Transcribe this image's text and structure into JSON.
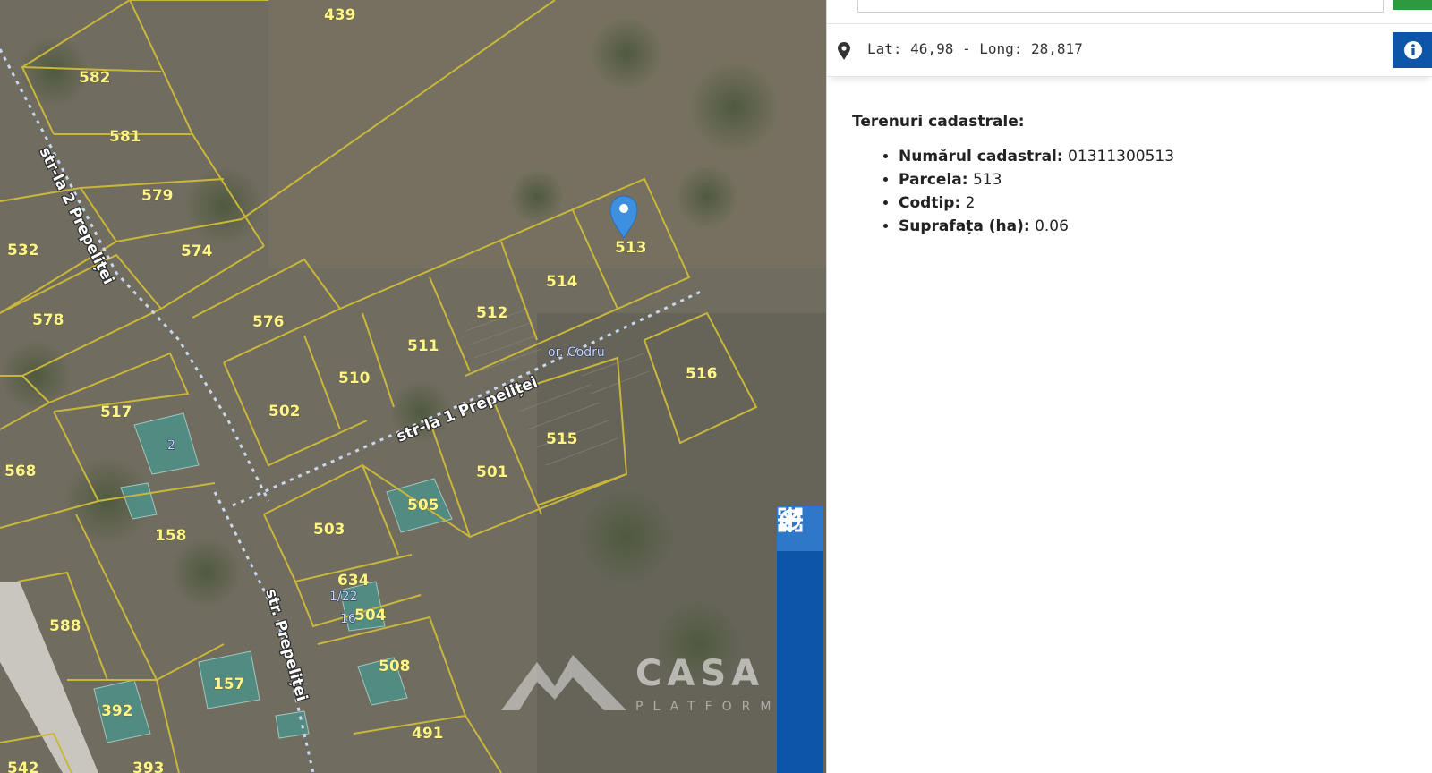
{
  "map": {
    "parcels": [
      "439",
      "582",
      "581",
      "579",
      "574",
      "532",
      "578",
      "576",
      "513",
      "514",
      "512",
      "511",
      "510",
      "502",
      "517",
      "2",
      "516",
      "515",
      "501",
      "505",
      "503",
      "568",
      "158",
      "634",
      "1/22",
      "16",
      "504",
      "588",
      "508",
      "157",
      "392",
      "491",
      "542",
      "393"
    ],
    "streets": [
      "str-la 2 Prepeliței",
      "str-la 1 Prepeliței",
      "str. Prepeliței"
    ],
    "area_name": "or. Codru",
    "watermark": {
      "title": "CASA M",
      "subtitle": "PLATFORMĂ I"
    },
    "controls": [
      "locate-icon",
      "zoom-in-icon",
      "zoom-out-icon",
      "fit-extent-icon",
      "fullscreen-icon",
      "more-icon"
    ],
    "colors": {
      "parcel_line": "#c8b73a",
      "controls_bg": "#0d55a8",
      "marker": "#3d8fe0"
    }
  },
  "panel": {
    "search": {
      "value": ""
    },
    "coordinates": "Lat: 46,98 - Long: 28,817",
    "section_title": "Terenuri cadastrale:",
    "fields": [
      {
        "label": "Numărul cadastral:",
        "value": "01311300513"
      },
      {
        "label": "Parcela:",
        "value": "513"
      },
      {
        "label": "Codtip:",
        "value": "2"
      },
      {
        "label": "Suprafața (ha):",
        "value": "0.06"
      }
    ]
  }
}
